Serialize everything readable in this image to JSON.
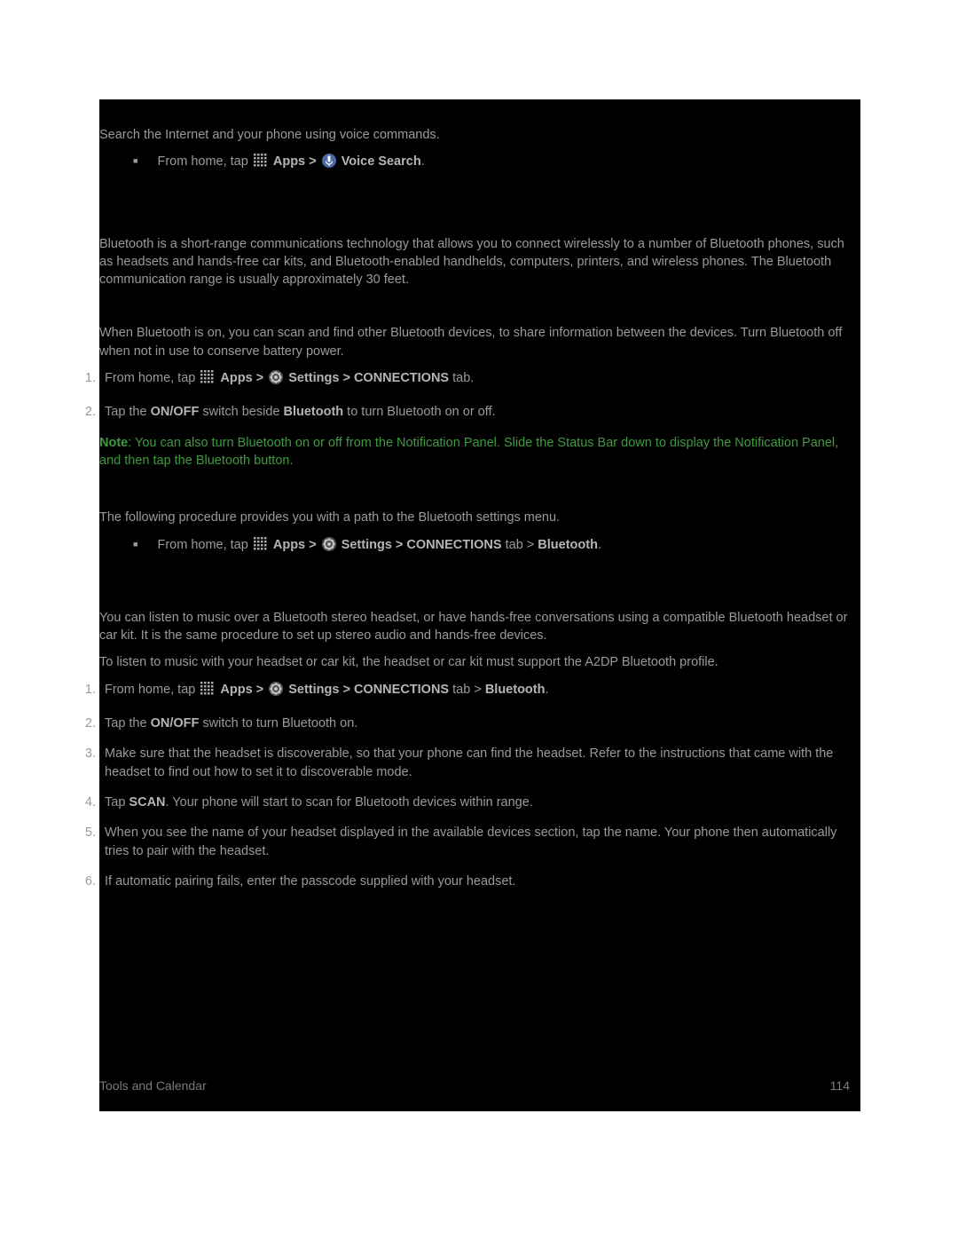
{
  "voiceSearch": {
    "intro": "Search the Internet and your phone using voice commands.",
    "step": {
      "prefix": "From home, tap ",
      "apps": "Apps",
      "gt": " > ",
      "target": "Voice Search",
      "period": "."
    }
  },
  "bluetooth": {
    "intro": "Bluetooth is a short-range communications technology that allows you to connect wirelessly to a number of Bluetooth phones, such as headsets and hands-free car kits, and Bluetooth-enabled handhelds, computers, printers, and wireless phones. The Bluetooth communication range is usually approximately 30 feet.",
    "onOff": {
      "intro": "When Bluetooth is on, you can scan and find other Bluetooth devices, to share information between the devices. Turn Bluetooth off when not in use to conserve battery power.",
      "steps": {
        "s1_prefix": "From home, tap ",
        "s1_apps": "Apps",
        "s1_gt1": " > ",
        "s1_settings": "Settings",
        "s1_gt2": " > ",
        "s1_conn": "CONNECTIONS",
        "s1_tab": " tab.",
        "s2_a": "Tap the ",
        "s2_b": "ON/OFF",
        "s2_c": " switch beside ",
        "s2_d": "Bluetooth",
        "s2_e": " to turn Bluetooth on or off."
      },
      "note": {
        "label": "Note",
        "text": ": You can also turn Bluetooth on or off from the Notification Panel. Slide the Status Bar down to display the Notification Panel, and then tap the Bluetooth button."
      }
    },
    "settingsMenu": {
      "intro": "The following procedure provides you with a path to the Bluetooth settings menu.",
      "step": {
        "prefix": "From home, tap ",
        "apps": "Apps",
        "gt1": " > ",
        "settings": "Settings",
        "gt2": " > ",
        "conn": "CONNECTIONS",
        "tab": " tab > ",
        "bt": "Bluetooth",
        "period": "."
      }
    },
    "connect": {
      "intro1": "You can listen to music over a Bluetooth stereo headset, or have hands-free conversations using a compatible Bluetooth headset or car kit. It is the same procedure to set up stereo audio and hands-free devices.",
      "intro2": "To listen to music with your headset or car kit, the headset or car kit must support the A2DP Bluetooth profile.",
      "steps": {
        "s1_prefix": "From home, tap ",
        "s1_apps": "Apps",
        "s1_gt1": " > ",
        "s1_settings": "Settings",
        "s1_gt2": " > ",
        "s1_conn": "CONNECTIONS",
        "s1_tab": " tab > ",
        "s1_bt": "Bluetooth",
        "s1_period": ".",
        "s2_a": "Tap the ",
        "s2_b": "ON/OFF",
        "s2_c": " switch to turn Bluetooth on.",
        "s3": "Make sure that the headset is discoverable, so that your phone can find the headset. Refer to the instructions that came with the headset to find out how to set it to discoverable mode.",
        "s4_a": "Tap ",
        "s4_b": "SCAN",
        "s4_c": ". Your phone will start to scan for Bluetooth devices within range.",
        "s5": "When you see the name of your headset displayed in the available devices section, tap the name. Your phone then automatically tries to pair with the headset.",
        "s6": "If automatic pairing fails, enter the passcode supplied with your headset."
      }
    }
  },
  "footer": {
    "left": "Tools and Calendar",
    "right": "114"
  }
}
